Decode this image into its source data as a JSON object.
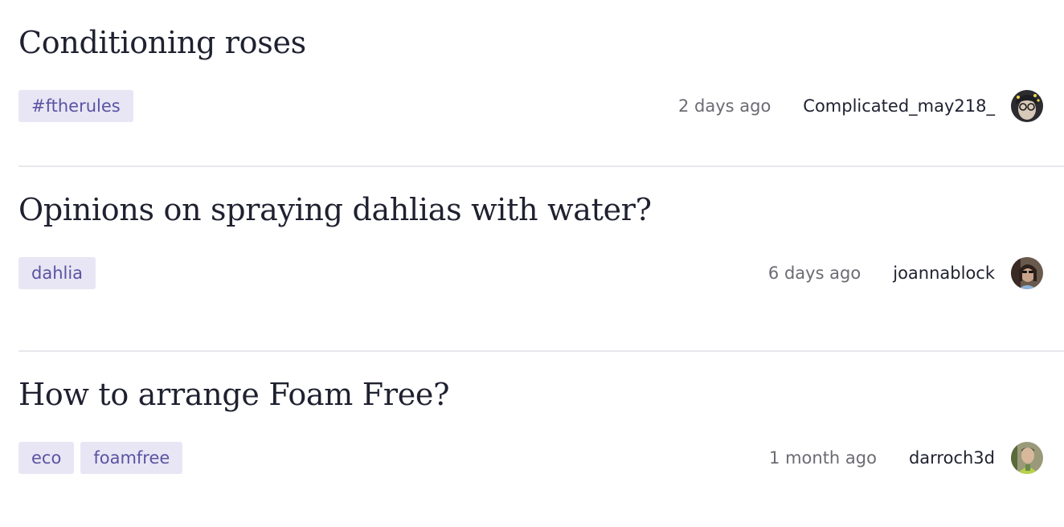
{
  "threads": [
    {
      "title": "Conditioning roses",
      "tags": [
        "#ftherules"
      ],
      "time": "2 days ago",
      "author": "Complicated_may218_",
      "avatar_colors": [
        "#2b2b30",
        "#d7c8b8",
        "#f2d94a",
        "#7a6a5a"
      ]
    },
    {
      "title": "Opinions on spraying dahlias with water?",
      "tags": [
        "dahlia"
      ],
      "time": "6 days ago",
      "author": "joannablock",
      "avatar_colors": [
        "#3a2a24",
        "#c9a48c",
        "#8fb3d9",
        "#5b4a3f"
      ]
    },
    {
      "title": "How to arrange Foam Free?",
      "tags": [
        "eco",
        "foamfree"
      ],
      "time": "1 month ago",
      "author": "darroch3d",
      "avatar_colors": [
        "#6b8a4a",
        "#d8b89a",
        "#b7d24a",
        "#3b3b2b"
      ]
    }
  ],
  "colors": {
    "tag_bg": "#e8e6f4",
    "tag_text": "#5a53a3",
    "divider": "#e8e8ec",
    "time_text": "#6b6b73"
  }
}
